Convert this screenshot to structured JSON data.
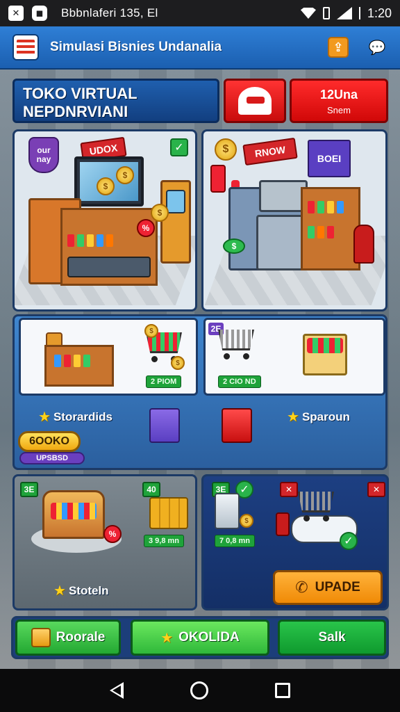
{
  "status_bar": {
    "app_icon_glyph": "✕",
    "notification_text": "Bbbnlaferi 135, El",
    "time": "1:20"
  },
  "app_bar": {
    "title": "Simulasi Bisnies Undanalia",
    "logo_icon": "store-flag-icon",
    "upgrade_icon": "arrow-up-icon",
    "chat_icon": "chat-icon"
  },
  "banner": {
    "line1": "TOKO VIRTUAL",
    "line2": "NEPDNRVIANI"
  },
  "red_badge": {
    "title": "12Una",
    "subtitle": "Snem"
  },
  "shop1": {
    "sign": "UDOX",
    "shield_text": "our nay"
  },
  "shop2": {
    "sign": "RNOW",
    "box_text": "BOEI"
  },
  "mid": {
    "card1_price": "2 PIOM",
    "card2_badge": "2E",
    "card2_price": "2 CIO ND",
    "label_left": "Storardids",
    "label_right": "Sparoun",
    "gold_button": "6OOKO",
    "purple_button": "UPSBSD"
  },
  "low1": {
    "tag1": "3E",
    "tag2": "40",
    "price": "3 9,8 mn",
    "label": "Stoteln"
  },
  "low2": {
    "tag1": "3E",
    "price": "7 0,8 mn",
    "upgrade_button": "UPADE"
  },
  "bottom": {
    "button1": "Roorale",
    "button2": "OKOLIDA",
    "button3": "Salk"
  },
  "colors": {
    "app_bar": "#1b5fb0",
    "accent_red": "#d10808",
    "accent_green": "#23a832",
    "accent_orange": "#f08a06"
  }
}
